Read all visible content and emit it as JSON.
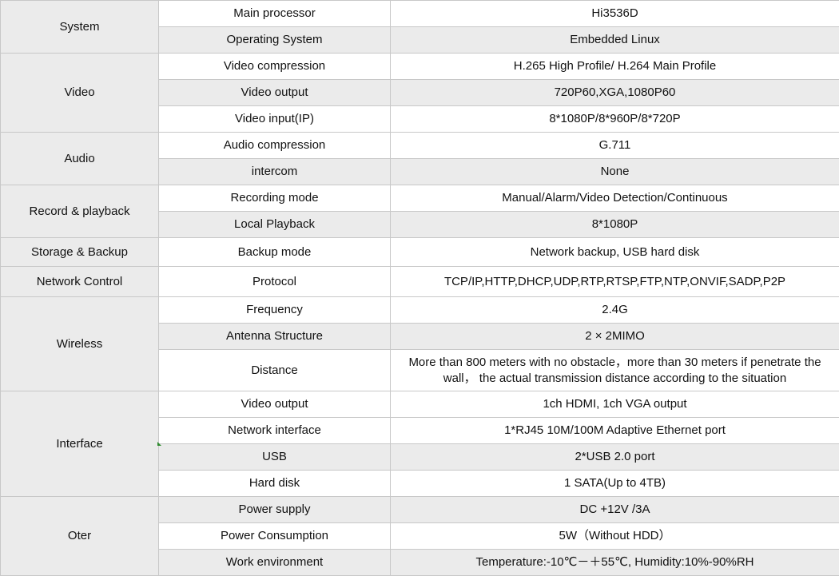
{
  "rows": [
    {
      "category": "System",
      "feature": "Main processor",
      "value": "Hi3536D"
    },
    {
      "category": "System",
      "feature": "Operating System",
      "value": "Embedded Linux"
    },
    {
      "category": "Video",
      "feature": "Video compression",
      "value": "H.265 High Profile/ H.264 Main Profile"
    },
    {
      "category": "Video",
      "feature": "Video output",
      "value": "720P60,XGA,1080P60"
    },
    {
      "category": "Video",
      "feature": "Video input(IP)",
      "value": "8*1080P/8*960P/8*720P"
    },
    {
      "category": "Audio",
      "feature": "Audio compression",
      "value": "G.711"
    },
    {
      "category": "Audio",
      "feature": "intercom",
      "value": "None"
    },
    {
      "category": "Record & playback",
      "feature": "Recording mode",
      "value": "Manual/Alarm/Video Detection/Continuous"
    },
    {
      "category": "Record & playback",
      "feature": "Local Playback",
      "value": "8*1080P"
    },
    {
      "category": "Storage & Backup",
      "feature": "Backup mode",
      "value": "Network backup, USB hard disk"
    },
    {
      "category": "Network Control",
      "feature": "Protocol",
      "value": "TCP/IP,HTTP,DHCP,UDP,RTP,RTSP,FTP,NTP,ONVIF,SADP,P2P"
    },
    {
      "category": "Wireless",
      "feature": "Frequency",
      "value": "2.4G"
    },
    {
      "category": "Wireless",
      "feature": "Antenna Structure",
      "value": "2 × 2MIMO"
    },
    {
      "category": "Wireless",
      "feature": "Distance",
      "value": "More than 800 meters with no obstacle，more than 30 meters if penetrate the wall， the actual transmission distance according to the situation"
    },
    {
      "category": "Interface",
      "feature": "Video output",
      "value": "1ch HDMI, 1ch VGA output"
    },
    {
      "category": "Interface",
      "feature": "Network interface",
      "value": "1*RJ45 10M/100M Adaptive Ethernet port"
    },
    {
      "category": "Interface",
      "feature": "USB",
      "value": "2*USB 2.0 port"
    },
    {
      "category": "Interface",
      "feature": "Hard disk",
      "value": "1 SATA(Up to 4TB)"
    },
    {
      "category": "Oter",
      "feature": "Power supply",
      "value": "DC +12V /3A"
    },
    {
      "category": "Oter",
      "feature": "Power Consumption",
      "value": "5W（Without HDD）"
    },
    {
      "category": "Oter",
      "feature": "Work environment",
      "value": "Temperature:-10℃－＋55℃, Humidity:10%-90%RH"
    }
  ],
  "colors": {
    "stripe": "#ebebeb",
    "border": "#c8c8c8",
    "marker": "#2e8b2e"
  }
}
